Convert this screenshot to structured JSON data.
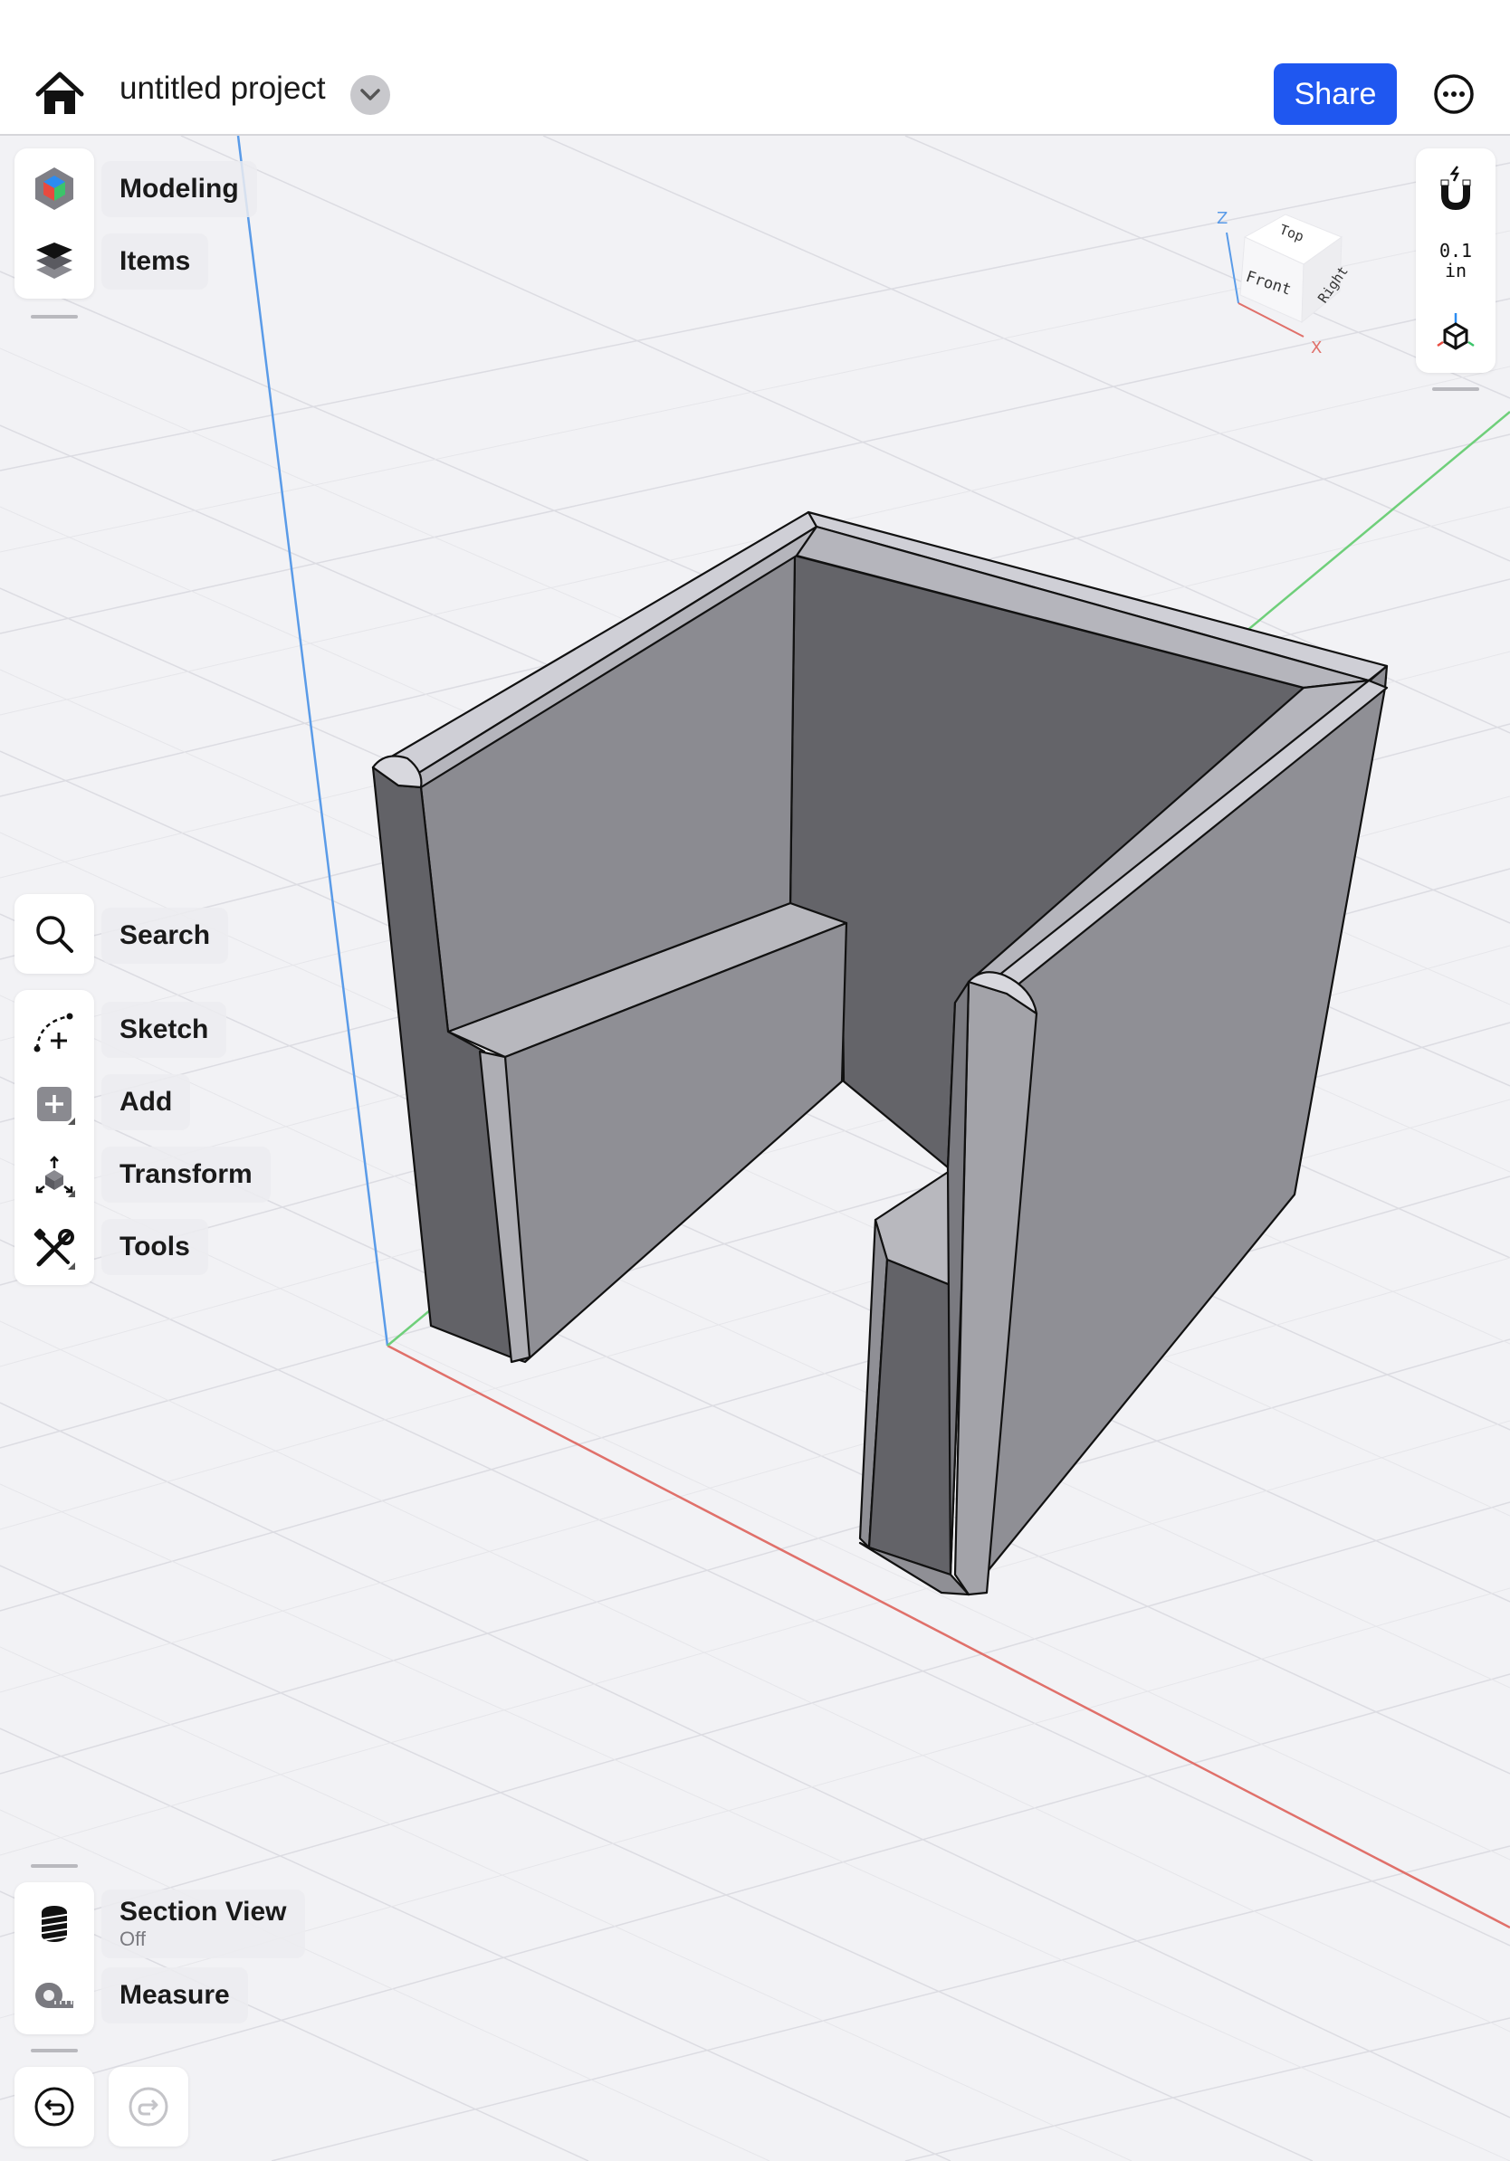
{
  "header": {
    "title": "untitled project",
    "share_label": "Share"
  },
  "left_top_menu": [
    {
      "label": "Modeling",
      "icon": "modeling-cube-icon"
    },
    {
      "label": "Items",
      "icon": "layers-icon"
    }
  ],
  "left_tools": {
    "search": {
      "label": "Search",
      "icon": "search-icon"
    },
    "sketch": {
      "label": "Sketch",
      "icon": "sketch-icon"
    },
    "add": {
      "label": "Add",
      "icon": "add-icon"
    },
    "transform": {
      "label": "Transform",
      "icon": "transform-icon"
    },
    "tools": {
      "label": "Tools",
      "icon": "tools-icon"
    }
  },
  "left_bottom": {
    "section_view": {
      "label": "Section View",
      "sub": "Off",
      "icon": "section-view-icon"
    },
    "measure": {
      "label": "Measure",
      "icon": "tape-measure-icon"
    }
  },
  "right_panel": {
    "snap_icon": "magnet-icon",
    "grid_unit_value": "0.1",
    "grid_unit": "in",
    "view_icon": "axes-cube-icon"
  },
  "view_cube": {
    "top": "Top",
    "front": "Front",
    "right": "Right",
    "axis_z": "Z",
    "axis_x": "X"
  },
  "colors": {
    "accent": "#1f57f0",
    "axis_x": "#e0706a",
    "axis_y": "#6fcf7a",
    "axis_z": "#5a9be8",
    "model_light": "#8f8f94",
    "model_dark": "#636368"
  }
}
